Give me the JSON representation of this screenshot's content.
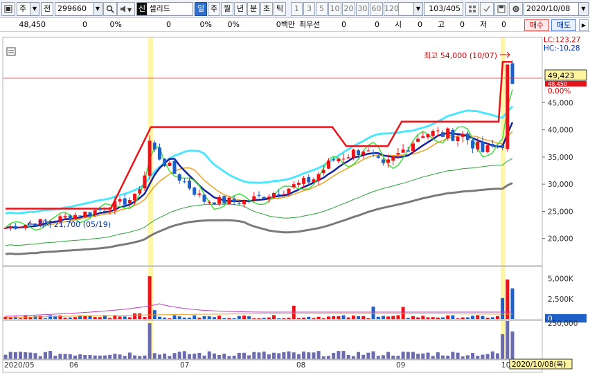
{
  "toolbar": {
    "market": "주",
    "mode": "전",
    "code": "299660",
    "stock_name": "셀리드",
    "stock_tag": "신",
    "periods": [
      "일",
      "주",
      "월",
      "년",
      "분",
      "초",
      "틱"
    ],
    "active_period": "일",
    "intervals": [
      "1",
      "3",
      "5",
      "10",
      "20",
      "30",
      "60",
      "120"
    ],
    "count": "103/405",
    "date": "2020/10/08"
  },
  "inforow": {
    "price": "48,450",
    "v1": "0",
    "p1": "0%",
    "v2": "0",
    "p2": "0%",
    "p3": "0%",
    "volume_label": "0백만",
    "best_label": "최우선",
    "v3": "0",
    "v4": "0",
    "si_label": "시",
    "si_val": "0",
    "go_label": "고",
    "go_val": "0",
    "jeo_label": "저",
    "jeo_val": "0",
    "buy": "매수",
    "sell": "매도"
  },
  "chart": {
    "lc_label": "LC:123,27",
    "hc_label": "HC:-10,28",
    "high_annotation": "최고 54,000 (10/07)",
    "low_annotation": "최저 21,700 (05/19)",
    "current_price": "49,423",
    "prev_price": "48,450",
    "change_pct": "0,00%",
    "price_ticks": [
      "45,000",
      "40,000",
      "35,000",
      "30,000",
      "25,000",
      "20,000"
    ],
    "volume_ticks": [
      "5,000K",
      "2,500K",
      "0"
    ],
    "vol2_ticks": [
      "250,000"
    ],
    "months": [
      "2020/05",
      "06",
      "07",
      "08",
      "09",
      "10"
    ],
    "cursor_date": "2020/10/08(목)"
  },
  "colors": {
    "up": "#e8141a",
    "down": "#1e60c8",
    "ma5": "#e8141a",
    "ma20": "#13219a",
    "ma60": "#f0a020",
    "ma120": "#2aa33a",
    "ma240": "#7a7a7a",
    "band": "#4fe6ff",
    "green": "#3de23d",
    "highlight": "#fff6a8"
  }
}
